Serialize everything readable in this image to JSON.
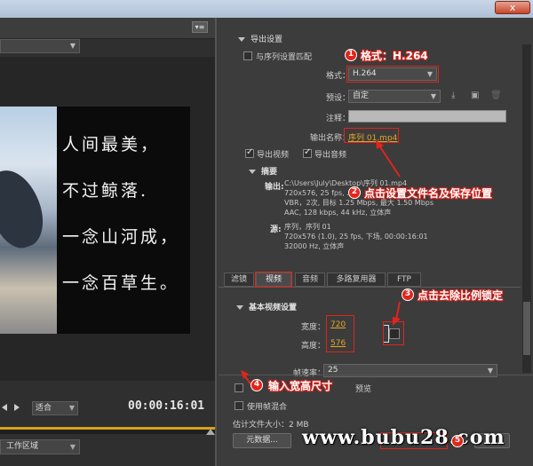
{
  "window": {
    "close_glyph": "x"
  },
  "left": {
    "panel_menu_glyph": "▾≡",
    "poem_lines": [
      "人间最美，",
      "不过鲸落.",
      "一念山河成，",
      "一念百草生。"
    ],
    "zoom_value": "适合",
    "timecode": "00:00:16:01",
    "workspace_label": "工作区域"
  },
  "export": {
    "section_title": "导出设置",
    "match_sequence_label": "与序列设置匹配",
    "format_label": "格式：",
    "format_value": "H.264",
    "preset_label": "预设：",
    "preset_value": "自定",
    "comment_label": "注释：",
    "output_name_label": "输出名称：",
    "output_name_value": "序列 01.mp4",
    "export_video_label": "导出视频",
    "export_audio_label": "导出音频",
    "summary_title": "摘要",
    "output_key": "输出:",
    "output_lines": [
      "C:\\Users\\July\\Desktop\\序列 01.mp4",
      "720x576, 25 fps, ...",
      "VBR，2次, 目标 1.25 Mbps, 最大 1.50 Mbps",
      "AAC, 128 kbps, 44 kHz, 立体声"
    ],
    "source_key": "源:",
    "source_lines": [
      "序列，序列 01",
      "720x576 (1.0), 25 fps, 下场, 00:00:16:01",
      "32000 Hz, 立体声"
    ]
  },
  "tabs": [
    "滤镜",
    "视频",
    "音频",
    "多路复用器",
    "FTP"
  ],
  "video": {
    "section_title": "基本视频设置",
    "width_label": "宽度：",
    "width_value": "720",
    "height_label": "高度：",
    "height_value": "576",
    "framerate_label": "帧速率：",
    "framerate_value": "25",
    "preview_option_suffix": "预览",
    "blend_label": "使用帧混合",
    "filesize_label": "估计文件大小：2 MB",
    "metadata_button": "元数据..."
  },
  "annotations": {
    "n1": "1",
    "t1": "格式：H.264",
    "n2": "2",
    "t2": "点击设置文件名及保存位置",
    "n3": "3",
    "t3": "点击去除比例锁定",
    "n4": "4",
    "t4": "输入宽高尺寸",
    "n5": "5"
  },
  "watermark": "www.bubu28.com",
  "colors": {
    "accent_orange": "#e1a52a",
    "annotation_red": "#e1241c"
  }
}
